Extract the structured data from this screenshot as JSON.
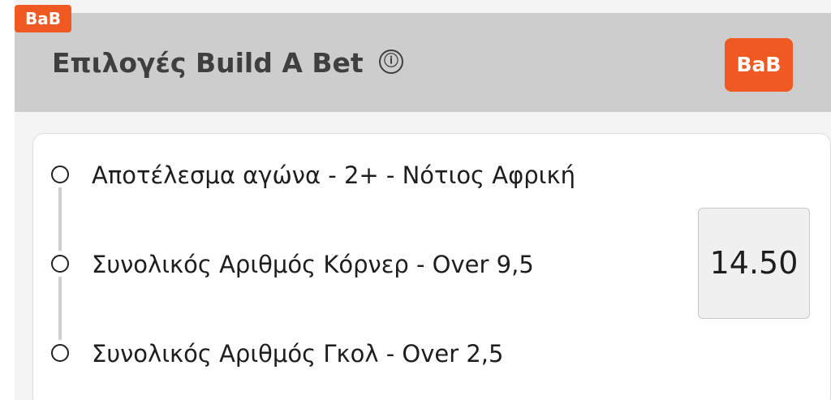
{
  "corner_tag": "BaB",
  "header": {
    "title": "Επιλογές Build A Bet",
    "info_icon": "ⓘ",
    "badge_label": "BaB"
  },
  "bet": {
    "selections": [
      {
        "label": "Αποτέλεσμα αγώνα - 2+ - Νότιος Αφρική"
      },
      {
        "label": "Συνολικός Αριθμός Κόρνερ - Over 9,5"
      },
      {
        "label": "Συνολικός Αριθμός Γκολ - Over 2,5"
      }
    ],
    "odds": "14.50"
  },
  "colors": {
    "accent": "#f05a22",
    "header_bg": "#cdcdcd",
    "text": "#1e1e1e"
  }
}
